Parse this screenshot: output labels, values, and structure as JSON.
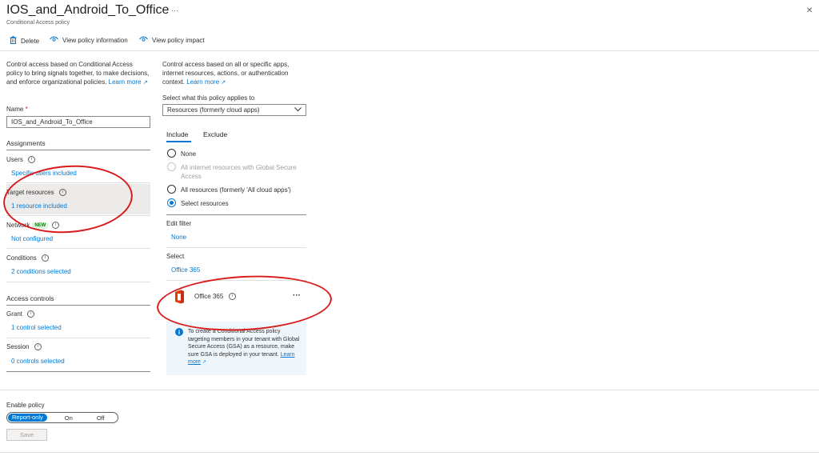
{
  "header": {
    "title": "IOS_and_Android_To_Office",
    "more_label": "···",
    "subtitle": "Conditional Access policy",
    "close_label": "✕"
  },
  "toolbar": {
    "delete_label": "Delete",
    "view_info_label": "View policy information",
    "view_impact_label": "View policy impact"
  },
  "left": {
    "intro": "Control access based on Conditional Access policy to bring signals together, to make decisions, and enforce organizational policies.",
    "learn_more": "Learn more",
    "name_label": "Name",
    "name_required": "*",
    "name_value": "IOS_and_Android_To_Office",
    "assignments_heading": "Assignments",
    "users_label": "Users",
    "users_value": "Specific users included",
    "target_label": "Target resources",
    "target_value": "1 resource included",
    "network_label": "Network",
    "network_badge": "NEW",
    "network_value": "Not configured",
    "conditions_label": "Conditions",
    "conditions_value": "2 conditions selected",
    "access_heading": "Access controls",
    "grant_label": "Grant",
    "grant_value": "1 control selected",
    "session_label": "Session",
    "session_value": "0 controls selected"
  },
  "right": {
    "intro": "Control access based on all or specific apps, internet resources, actions, or authentication context.",
    "learn_more": "Learn more",
    "select_applies_label": "Select what this policy applies to",
    "dropdown_value": "Resources (formerly cloud apps)",
    "tab_include": "Include",
    "tab_exclude": "Exclude",
    "options": {
      "none": "None",
      "internet": "All internet resources with Global Secure Access",
      "all": "All resources (formerly 'All cloud apps')",
      "select": "Select resources"
    },
    "edit_filter_label": "Edit filter",
    "edit_filter_value": "None",
    "select_label": "Select",
    "select_value": "Office 365",
    "app_name": "Office 365",
    "app_more": "···",
    "info_text": "To create a Conditional Access policy targeting members in your tenant with Global Secure Access (GSA) as a resource, make sure GSA is deployed in your tenant.",
    "info_learn_more": "Learn more"
  },
  "footer": {
    "enable_label": "Enable policy",
    "toggle_report": "Report-only",
    "toggle_on": "On",
    "toggle_off": "Off",
    "save_label": "Save"
  },
  "colors": {
    "accent": "#0078d4",
    "annotation": "#d81b1b",
    "office_logo": "#d83b01"
  }
}
